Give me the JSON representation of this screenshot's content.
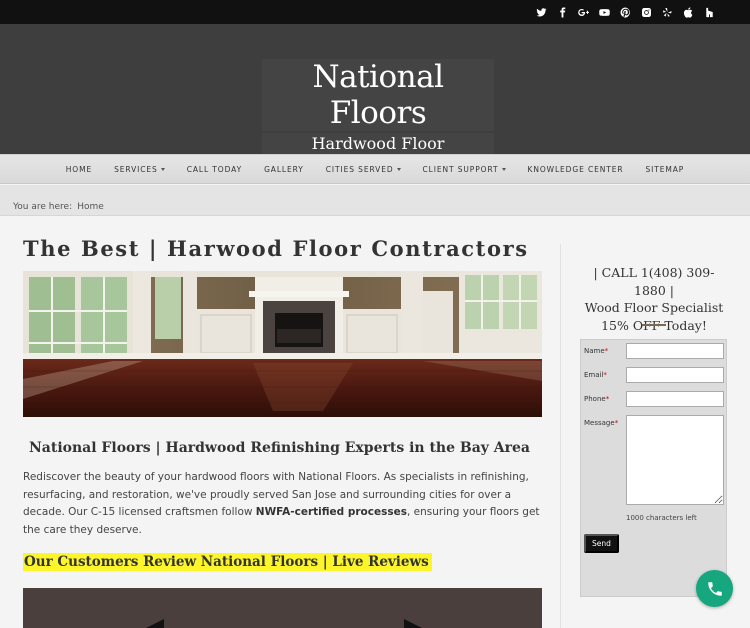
{
  "social": {
    "icons": [
      "twitter-icon",
      "facebook-icon",
      "google-plus-icon",
      "youtube-icon",
      "pinterest-icon",
      "instagram-icon",
      "yelp-icon",
      "apple-icon",
      "houzz-icon"
    ]
  },
  "header": {
    "title": "National Floors",
    "subtitle": "Hardwood Floor Contractors"
  },
  "nav": {
    "items": [
      {
        "label": "HOME"
      },
      {
        "label": "SERVICES"
      },
      {
        "label": "CALL TODAY"
      },
      {
        "label": "GALLERY"
      },
      {
        "label": "CITIES SERVED"
      },
      {
        "label": "CLIENT SUPPORT"
      },
      {
        "label": "KNOWLEDGE CENTER"
      },
      {
        "label": "SITEMAP"
      }
    ]
  },
  "breadcrumb": {
    "prefix": "You are here:",
    "current": "Home"
  },
  "main": {
    "title": "The Best | Harwood Floor Contractors",
    "subtitle": "National Floors | Hardwood Refinishing Experts in the Bay Area",
    "intro_before": "Rediscover the beauty of your hardwood floors with National Floors. As specialists in refinishing, resurfacing, and restoration, we've proudly served San Jose and surrounding cities for over a decade. Our C-15 licensed craftsmen follow ",
    "intro_bold": "NWFA-certified processes",
    "intro_after": ", ensuring your floors get the care they deserve.",
    "reviews_heading": "Our Customers Review National Floors | Live Reviews"
  },
  "sidebar": {
    "call_line": "| CALL 1(408) 309-1880 |",
    "specialist_line": "Wood Floor Specialist",
    "offer_line": "15% OFF Today!"
  },
  "form": {
    "name_label": "Name",
    "email_label": "Email",
    "phone_label": "Phone",
    "message_label": "Message",
    "required_mark": "*",
    "chars_left": "1000 characters left",
    "send_label": "Send"
  },
  "colors": {
    "highlight": "#fbf52a",
    "phone_button": "#16a77f",
    "header_bg": "#3e3e3e"
  }
}
